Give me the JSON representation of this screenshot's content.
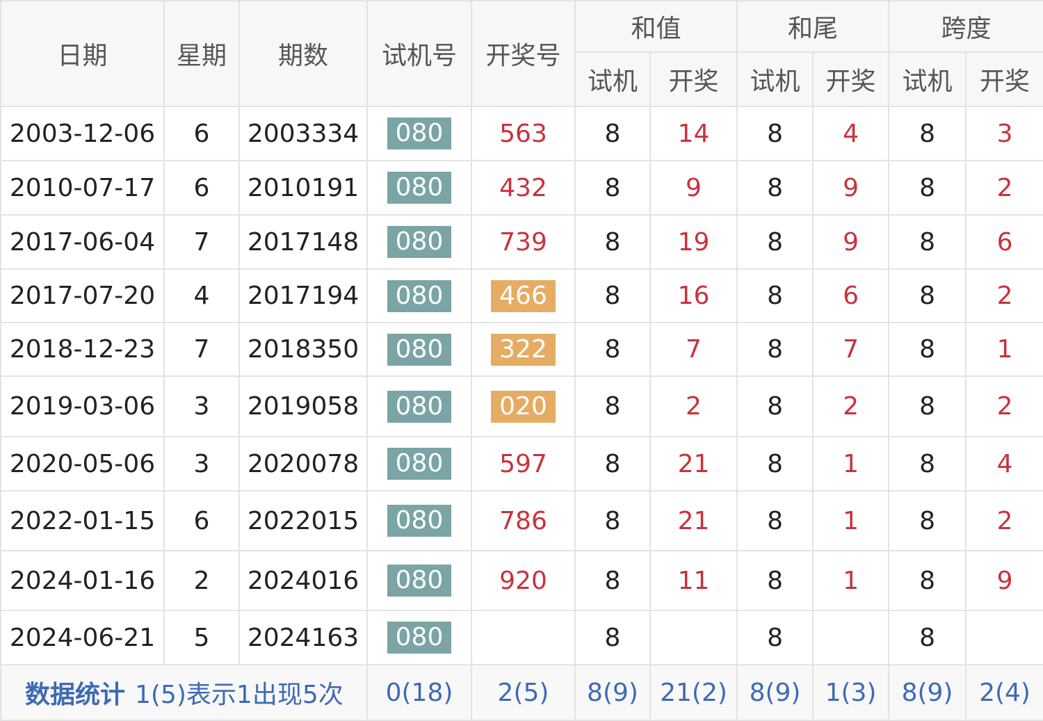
{
  "header": {
    "date": "日期",
    "weekday": "星期",
    "issue": "期数",
    "test_number": "试机号",
    "draw_number": "开奖号",
    "sum_group": "和值",
    "tail_group": "和尾",
    "span_group": "跨度",
    "sub_test": "试机",
    "sub_draw": "开奖"
  },
  "rows": [
    {
      "date": "2003-12-06",
      "weekday": "6",
      "issue": "2003334",
      "test": "080",
      "draw": "563",
      "draw_highlight": false,
      "sum_test": "8",
      "sum_draw": "14",
      "tail_test": "8",
      "tail_draw": "4",
      "span_test": "8",
      "span_draw": "3"
    },
    {
      "date": "2010-07-17",
      "weekday": "6",
      "issue": "2010191",
      "test": "080",
      "draw": "432",
      "draw_highlight": false,
      "sum_test": "8",
      "sum_draw": "9",
      "tail_test": "8",
      "tail_draw": "9",
      "span_test": "8",
      "span_draw": "2"
    },
    {
      "date": "2017-06-04",
      "weekday": "7",
      "issue": "2017148",
      "test": "080",
      "draw": "739",
      "draw_highlight": false,
      "sum_test": "8",
      "sum_draw": "19",
      "tail_test": "8",
      "tail_draw": "9",
      "span_test": "8",
      "span_draw": "6"
    },
    {
      "date": "2017-07-20",
      "weekday": "4",
      "issue": "2017194",
      "test": "080",
      "draw": "466",
      "draw_highlight": true,
      "sum_test": "8",
      "sum_draw": "16",
      "tail_test": "8",
      "tail_draw": "6",
      "span_test": "8",
      "span_draw": "2"
    },
    {
      "date": "2018-12-23",
      "weekday": "7",
      "issue": "2018350",
      "test": "080",
      "draw": "322",
      "draw_highlight": true,
      "sum_test": "8",
      "sum_draw": "7",
      "tail_test": "8",
      "tail_draw": "7",
      "span_test": "8",
      "span_draw": "1"
    },
    {
      "date": "2019-03-06",
      "weekday": "3",
      "issue": "2019058",
      "test": "080",
      "draw": "020",
      "draw_highlight": true,
      "sum_test": "8",
      "sum_draw": "2",
      "tail_test": "8",
      "tail_draw": "2",
      "span_test": "8",
      "span_draw": "2"
    },
    {
      "date": "2020-05-06",
      "weekday": "3",
      "issue": "2020078",
      "test": "080",
      "draw": "597",
      "draw_highlight": false,
      "sum_test": "8",
      "sum_draw": "21",
      "tail_test": "8",
      "tail_draw": "1",
      "span_test": "8",
      "span_draw": "4"
    },
    {
      "date": "2022-01-15",
      "weekday": "6",
      "issue": "2022015",
      "test": "080",
      "draw": "786",
      "draw_highlight": false,
      "sum_test": "8",
      "sum_draw": "21",
      "tail_test": "8",
      "tail_draw": "1",
      "span_test": "8",
      "span_draw": "2"
    },
    {
      "date": "2024-01-16",
      "weekday": "2",
      "issue": "2024016",
      "test": "080",
      "draw": "920",
      "draw_highlight": false,
      "sum_test": "8",
      "sum_draw": "11",
      "tail_test": "8",
      "tail_draw": "1",
      "span_test": "8",
      "span_draw": "9"
    },
    {
      "date": "2024-06-21",
      "weekday": "5",
      "issue": "2024163",
      "test": "080",
      "draw": "",
      "draw_highlight": false,
      "sum_test": "8",
      "sum_draw": "",
      "tail_test": "8",
      "tail_draw": "",
      "span_test": "8",
      "span_draw": ""
    }
  ],
  "stats": {
    "title": "数据统计",
    "note": "1(5)表示1出现5次",
    "test_number": "0(18)",
    "draw_number": "2(5)",
    "sum_test": "8(9)",
    "sum_draw": "21(2)",
    "tail_test": "8(9)",
    "tail_draw": "1(3)",
    "span_test": "8(9)",
    "span_draw": "2(4)"
  },
  "colors": {
    "test_badge": "#7aa4a5",
    "draw_highlight_badge": "#e5ac63",
    "draw_text": "#c8323c",
    "stats_text": "#3d6ab5",
    "grid": "#e3e3e3",
    "header_bg": "#f7f7f7"
  }
}
